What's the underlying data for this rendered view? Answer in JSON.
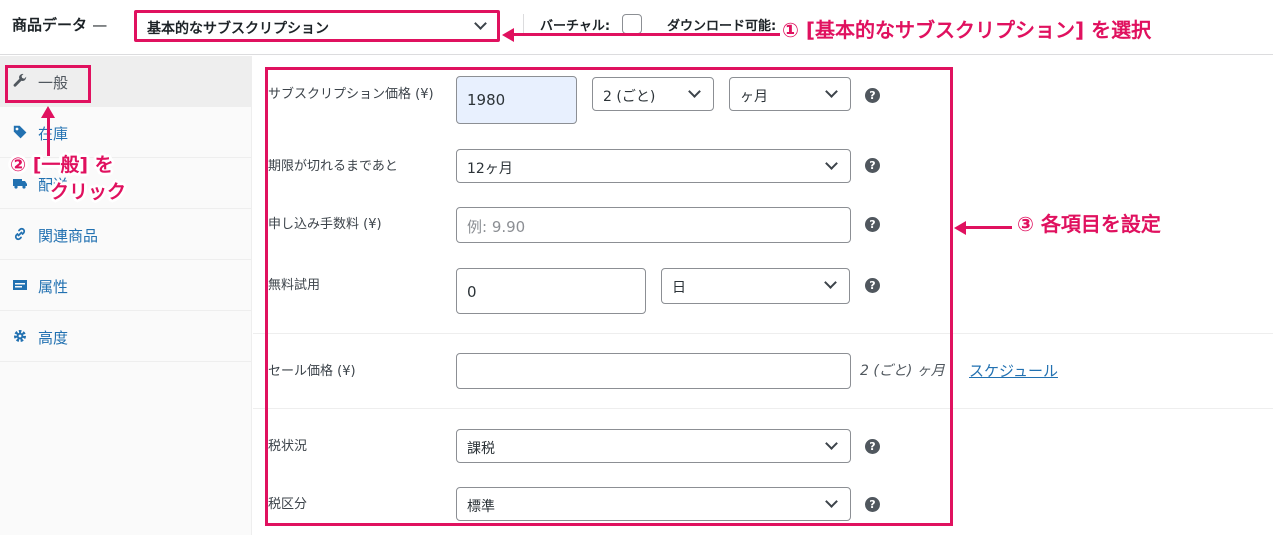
{
  "header": {
    "title": "商品データ",
    "title_dash": "—",
    "product_type": "基本的なサブスクリプション",
    "virtual_label": "バーチャル:",
    "download_label": "ダウンロード可能:"
  },
  "sidebar": {
    "tabs": [
      {
        "label": "一般",
        "icon": "wrench-icon",
        "active": true
      },
      {
        "label": "在庫",
        "icon": "tag-icon",
        "active": false
      },
      {
        "label": "配送",
        "icon": "truck-icon",
        "active": false
      },
      {
        "label": "関連商品",
        "icon": "link-icon",
        "active": false
      },
      {
        "label": "属性",
        "icon": "list-icon",
        "active": false
      },
      {
        "label": "高度",
        "icon": "gear-icon",
        "active": false
      }
    ]
  },
  "fields": {
    "subscription_price_label": "サブスクリプション価格 (¥)",
    "subscription_price_value": "1980",
    "interval_value": "2 (ごと)",
    "period_value": "ヶ月",
    "length_label": "期限が切れるまであと",
    "length_value": "12ヶ月",
    "signup_fee_label": "申し込み手数料 (¥)",
    "signup_fee_placeholder": "例: 9.90",
    "trial_label": "無料試用",
    "trial_value": "0",
    "trial_period_value": "日",
    "sale_price_label": "セール価格 (¥)",
    "sale_hint": "2 (ごと) ヶ月",
    "schedule_link": "スケジュール",
    "tax_status_label": "税状況",
    "tax_status_value": "課税",
    "tax_class_label": "税区分",
    "tax_class_value": "標準",
    "help_glyph": "?"
  },
  "annotations": {
    "step1": "① [基本的なサブスクリプション] を選択",
    "step2_line1": "② [一般] を",
    "step2_line2": "クリック",
    "step3": "③ 各項目を設定"
  },
  "colors": {
    "annotation": "#e0115f",
    "link": "#2271b1",
    "input_autofill": "#e8f0fe"
  }
}
